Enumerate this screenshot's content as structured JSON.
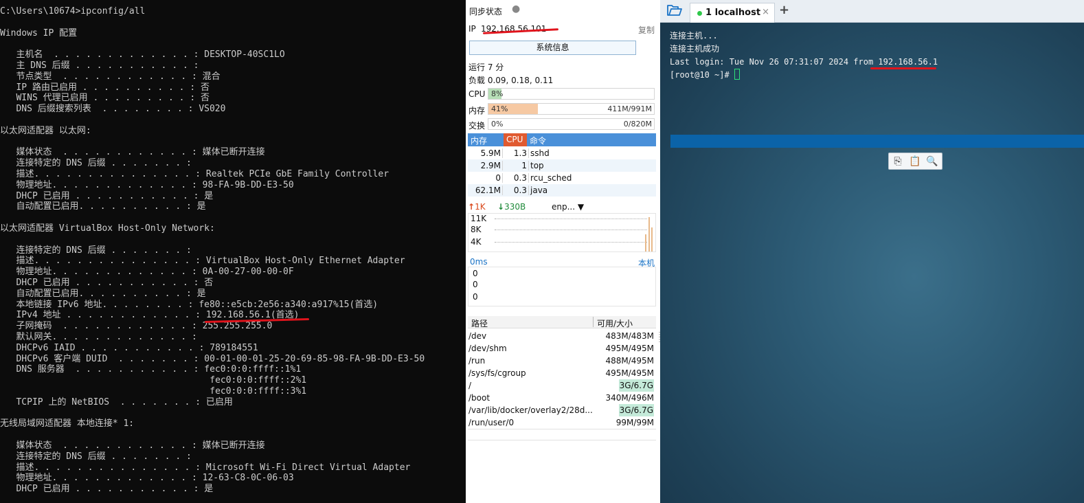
{
  "cmd": {
    "lines": [
      "C:\\Users\\10674>ipconfig/all",
      "",
      "Windows IP 配置",
      "",
      "   主机名  . . . . . . . . . . . . . : DESKTOP-40SC1LO",
      "   主 DNS 后缀 . . . . . . . . . . . :",
      "   节点类型  . . . . . . . . . . . . : 混合",
      "   IP 路由已启用 . . . . . . . . . . : 否",
      "   WINS 代理已启用 . . . . . . . . . : 否",
      "   DNS 后缀搜索列表  . . . . . . . . : VS020",
      "",
      "以太网适配器 以太网:",
      "",
      "   媒体状态  . . . . . . . . . . . . : 媒体已断开连接",
      "   连接特定的 DNS 后缀 . . . . . . . :",
      "   描述. . . . . . . . . . . . . . . : Realtek PCIe GbE Family Controller",
      "   物理地址. . . . . . . . . . . . . : 98-FA-9B-DD-E3-50",
      "   DHCP 已启用 . . . . . . . . . . . : 是",
      "   自动配置已启用. . . . . . . . . . : 是",
      "",
      "以太网适配器 VirtualBox Host-Only Network:",
      "",
      "   连接特定的 DNS 后缀 . . . . . . . :",
      "   描述. . . . . . . . . . . . . . . : VirtualBox Host-Only Ethernet Adapter",
      "   物理地址. . . . . . . . . . . . . : 0A-00-27-00-00-0F",
      "   DHCP 已启用 . . . . . . . . . . . : 否",
      "   自动配置已启用. . . . . . . . . . : 是",
      "   本地链接 IPv6 地址. . . . . . . . : fe80::e5cb:2e56:a340:a917%15(首选)",
      "   IPv4 地址 . . . . . . . . . . . . : 192.168.56.1(首选)",
      "   子网掩码  . . . . . . . . . . . . : 255.255.255.0",
      "   默认网关. . . . . . . . . . . . . :",
      "   DHCPv6 IAID . . . . . . . . . . . : 789184551",
      "   DHCPv6 客户端 DUID  . . . . . . . : 00-01-00-01-25-20-69-85-98-FA-9B-DD-E3-50",
      "   DNS 服务器  . . . . . . . . . . . : fec0:0:0:ffff::1%1",
      "                                       fec0:0:0:ffff::2%1",
      "                                       fec0:0:0:ffff::3%1",
      "   TCPIP 上的 NetBIOS  . . . . . . . : 已启用",
      "",
      "无线局域网适配器 本地连接* 1:",
      "",
      "   媒体状态  . . . . . . . . . . . . : 媒体已断开连接",
      "   连接特定的 DNS 后缀 . . . . . . . :",
      "   描述. . . . . . . . . . . . . . . : Microsoft Wi-Fi Direct Virtual Adapter",
      "   物理地址. . . . . . . . . . . . . : 12-63-C8-0C-06-03",
      "   DHCP 已启用 . . . . . . . . . . . : 是"
    ]
  },
  "monitor": {
    "sync_status": "同步状态",
    "ip_label": "IP",
    "ip_value": "192.168.56.101",
    "copy_label": "复制",
    "sysinfo_button": "系统信息",
    "uptime": "运行 7 分",
    "load": "负载 0.09, 0.18, 0.11",
    "cpu": {
      "label": "CPU",
      "percent_text": "8%",
      "fraction": 0.08,
      "amount": ""
    },
    "mem": {
      "label": "内存",
      "percent_text": "41%",
      "fraction": 0.3,
      "amount": "411M/991M"
    },
    "swap": {
      "label": "交换",
      "percent_text": "0%",
      "fraction": 0.0,
      "amount": "0/820M"
    },
    "proc_headers": [
      "内存",
      "CPU",
      "命令"
    ],
    "processes": [
      {
        "mem": "5.9M",
        "cpu": "1.3",
        "cmd": "sshd"
      },
      {
        "mem": "2.9M",
        "cpu": "1",
        "cmd": "top"
      },
      {
        "mem": "0",
        "cpu": "0.3",
        "cmd": "rcu_sched"
      },
      {
        "mem": "62.1M",
        "cpu": "0.3",
        "cmd": "java"
      }
    ],
    "net": {
      "up": "1K",
      "down": "330B",
      "iface": "enp...",
      "y_ticks": [
        "11K",
        "8K",
        "4K"
      ],
      "up_color": "#d9481b",
      "down_color": "#1f8a3a"
    },
    "ping": {
      "latency": "0ms",
      "host_label": "本机",
      "y_ticks": [
        "0",
        "0",
        "0"
      ]
    },
    "disk_headers": {
      "path": "路径",
      "size": "可用/大小"
    },
    "disks": [
      {
        "path": "/dev",
        "size": "483M/483M",
        "hl": false
      },
      {
        "path": "/dev/shm",
        "size": "495M/495M",
        "hl": false
      },
      {
        "path": "/run",
        "size": "488M/495M",
        "hl": false
      },
      {
        "path": "/sys/fs/cgroup",
        "size": "495M/495M",
        "hl": false
      },
      {
        "path": "/",
        "size": "3G/6.7G",
        "hl": true
      },
      {
        "path": "/boot",
        "size": "340M/496M",
        "hl": false
      },
      {
        "path": "/var/lib/docker/overlay2/28d...",
        "size": "3G/6.7G",
        "hl": true
      },
      {
        "path": "/run/user/0",
        "size": "99M/99M",
        "hl": false
      }
    ]
  },
  "terminal": {
    "tab_label": "1 localhost",
    "lines": [
      "连接主机...",
      "连接主机成功",
      "Last login: Tue Nov 26 07:31:07 2024 from 192.168.56.1"
    ],
    "prompt": "[root@10 ~]# ",
    "colors": {
      "accent_green": "#2fc84a",
      "selection": "#0b63a8"
    }
  },
  "annotations": {
    "underline_color": "#e0141c"
  }
}
